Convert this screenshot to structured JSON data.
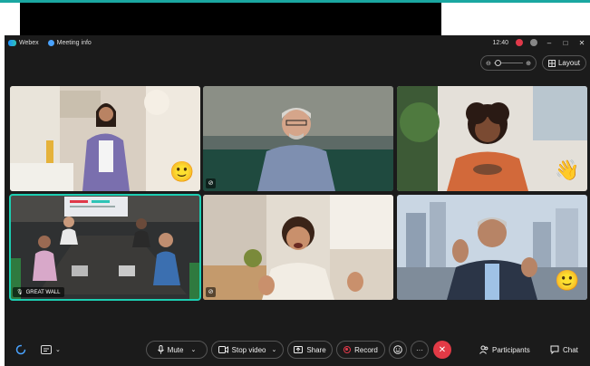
{
  "titlebar": {
    "app_name": "Webex",
    "meeting_info": "Meeting info",
    "time": "12:40"
  },
  "layout": {
    "label": "Layout",
    "zoom_minus": "⊖",
    "zoom_plus": "⊕"
  },
  "tiles": [
    {
      "emoji": "🙂"
    },
    {},
    {
      "emoji": "👋"
    },
    {
      "name": "GREAT WALL"
    },
    {},
    {
      "emoji": "🙂"
    }
  ],
  "controls": {
    "mute": "Mute",
    "stop_video": "Stop video",
    "share": "Share",
    "record": "Record",
    "participants": "Participants",
    "chat": "Chat",
    "more": "···",
    "end": "✕"
  },
  "colors": {
    "accent": "#1ccdb1",
    "end_call": "#e23a46",
    "record": "#e0394a"
  }
}
